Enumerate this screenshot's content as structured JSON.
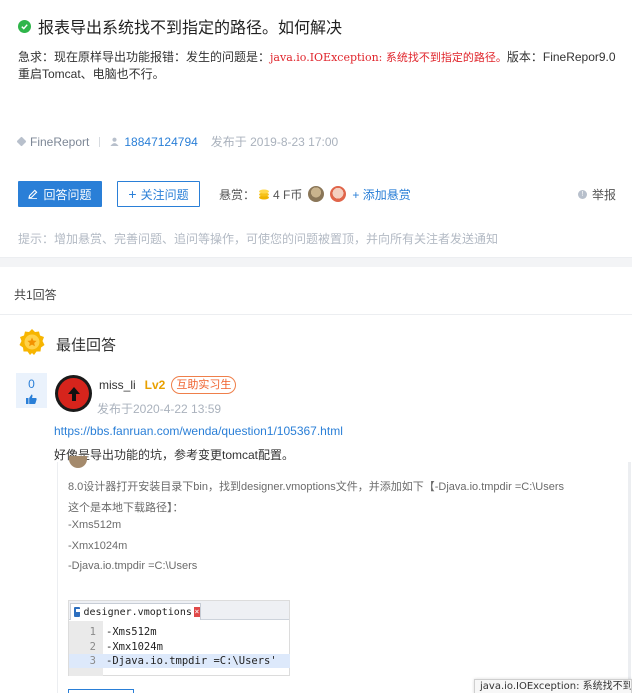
{
  "question": {
    "title": "报表导出系统找不到指定的路径。如何解决",
    "body_prefix": "急求：现在原样导出功能报错：发生的问题是：",
    "body_error": "java.io.IOException: 系统找不到指定的路径。",
    "body_suffix": "版本：FineRepor9.0",
    "body_line2": "重启Tomcat、电脑也不行。",
    "tag": "FineReport",
    "user_id": "18847124794",
    "published": "发布于 2019-8-23 17:00"
  },
  "actions": {
    "answer_label": "回答问题",
    "follow_label": "关注问题",
    "bounty_prefix": "悬赏：",
    "bounty_amount": "4 F币",
    "add_bounty_label": "+ 添加悬赏",
    "report_label": "举报",
    "hint": "提示：增加悬赏、完善问题、追问等操作，可使您的问题被置顶，并向所有关注者发送通知"
  },
  "answers": {
    "count_label": "共1回答",
    "best_label": "最佳回答",
    "votes": "0",
    "username": "miss_li",
    "level": "Lv2",
    "badge": "互助实习生",
    "published": "发布于2020-4-22 13:59",
    "link": "https://bbs.fanruan.com/wenda/question1/105367.html",
    "text": "好像是导出功能的坑，参考变更tomcat配置。",
    "embed": {
      "lines": [
        "8.0设计器打开安装目录下bin，找到designer.vmoptions文件，并添加如下【-Djava.io.tmpdir =C:\\Users",
        "这个是本地下载路径】：",
        "-Xms512m",
        "-Xmx1024m",
        "-Djava.io.tmpdir =C:\\Users"
      ],
      "editor_tab": "designer.vmoptions",
      "editor_close": "×",
      "code": [
        {
          "ln": "1",
          "text": "-Xms512m"
        },
        {
          "ln": "2",
          "text": "-Xmx1024m"
        },
        {
          "ln": "3",
          "text": "-Djava.io.tmpdir =C:\\Users'"
        }
      ]
    },
    "tooltip": "java.io.IOException: 系统找不到"
  },
  "colors": {
    "accent": "#2a7fd7",
    "error": "#e0252c",
    "success": "#2fb54a",
    "level": "#e8a000",
    "badge": "#ef5f2a"
  }
}
